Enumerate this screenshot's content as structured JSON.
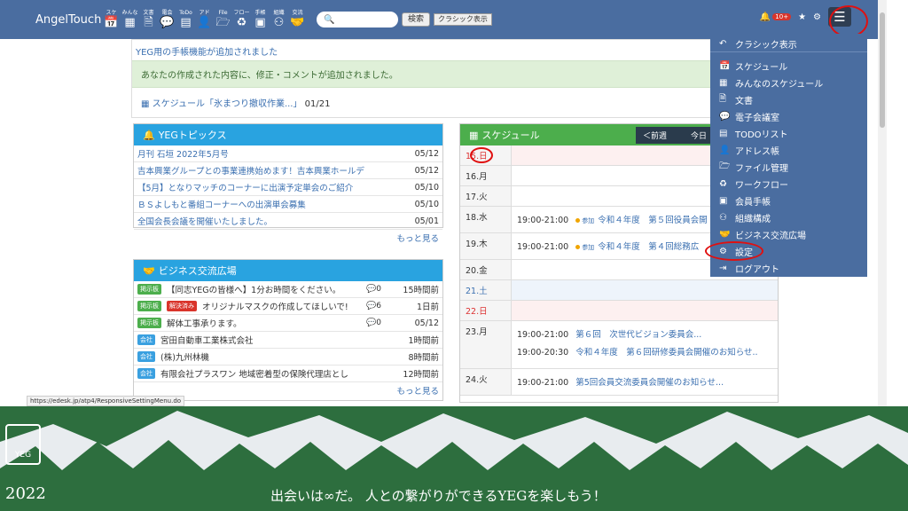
{
  "header": {
    "brand": "AngelTouch",
    "nav": [
      {
        "label": "スケ",
        "icon": "calendar-icon",
        "glyph": "📅"
      },
      {
        "label": "みんな",
        "icon": "group-calendar-icon",
        "glyph": "▦"
      },
      {
        "label": "文書",
        "icon": "document-icon",
        "glyph": "🗎"
      },
      {
        "label": "電会",
        "icon": "chat-icon",
        "glyph": "💬"
      },
      {
        "label": "ToDo",
        "icon": "todo-icon",
        "glyph": "▤"
      },
      {
        "label": "アド",
        "icon": "address-icon",
        "glyph": "👤"
      },
      {
        "label": "File",
        "icon": "folder-icon",
        "glyph": "🗁"
      },
      {
        "label": "フロー",
        "icon": "workflow-icon",
        "glyph": "♻"
      },
      {
        "label": "手帳",
        "icon": "notebook-icon",
        "glyph": "▣"
      },
      {
        "label": "組織",
        "icon": "org-icon",
        "glyph": "⚇"
      },
      {
        "label": "交流",
        "icon": "handshake-icon",
        "glyph": "🤝"
      }
    ],
    "search_placeholder": "",
    "search_button": "検索",
    "classic_button": "クラシック表示",
    "badge": "10+"
  },
  "notice": {
    "title": "YEG用の手帳機能が追加されました",
    "green": "あなたの作成された内容に、修正・コメントが追加されました。",
    "link": "スケジュール「氷まつり撤収作業...」",
    "link_date": "01/21"
  },
  "topics": {
    "title": "YEGトピックス",
    "rows": [
      {
        "title": "月刊 石垣 2022年5月号",
        "date": "05/12"
      },
      {
        "title": "吉本興業グループとの事業連携始めます！吉本興業ホールデ",
        "date": "05/12"
      },
      {
        "title": "【5月】となりマッチのコーナーに出演予定単会のご紹介",
        "date": "05/10"
      },
      {
        "title": "ＢＳよしもと番組コーナーへの出演単会募集",
        "date": "05/10"
      },
      {
        "title": "全国会長会議を開催いたしました。",
        "date": "05/01"
      }
    ],
    "more": "もっと見る"
  },
  "biz": {
    "title": "ビジネス交流広場",
    "rows": [
      {
        "tag": "掲示板",
        "tag2": "",
        "title": "【同志YEGの皆様へ】1分お時間をください。",
        "cmt": "0",
        "date": "15時間前"
      },
      {
        "tag": "掲示板",
        "tag2": "解決済み",
        "title": "オリジナルマスクの作成してほしいで!",
        "cmt": "6",
        "date": "1日前"
      },
      {
        "tag": "掲示板",
        "tag2": "",
        "title": "解体工事承ります。",
        "cmt": "0",
        "date": "05/12"
      },
      {
        "tag": "会社",
        "tag2": "",
        "title": "宮田自動車工業株式会社",
        "cmt": "",
        "date": "1時間前"
      },
      {
        "tag": "会社",
        "tag2": "",
        "title": "(株)九州林機",
        "cmt": "",
        "date": "8時間前"
      },
      {
        "tag": "会社",
        "tag2": "",
        "title": "有限会社プラスワン 地域密着型の保険代理店とし",
        "cmt": "",
        "date": "12時間前"
      }
    ],
    "more": "もっと見る"
  },
  "schedule": {
    "title": "スケジュール",
    "prev": "＜前週",
    "today": "今日",
    "days": [
      {
        "date": "15.日",
        "items": [],
        "color": "#d33",
        "bg": "#fdf0f0"
      },
      {
        "date": "16.月",
        "items": [],
        "color": "#333",
        "bg": "#fff"
      },
      {
        "date": "17.火",
        "items": [],
        "color": "#333",
        "bg": "#fff"
      },
      {
        "date": "18.水",
        "items": [
          {
            "tm": "19:00-21:00",
            "sanka": "参加",
            "title": "令和４年度　第５回役員会開"
          }
        ],
        "color": "#333",
        "bg": "#fff"
      },
      {
        "date": "19.木",
        "items": [
          {
            "tm": "19:00-21:00",
            "sanka": "参加",
            "title": "令和４年度　第４回総務広"
          }
        ],
        "color": "#333",
        "bg": "#fff"
      },
      {
        "date": "20.金",
        "items": [],
        "color": "#333",
        "bg": "#fff"
      },
      {
        "date": "21.土",
        "items": [],
        "color": "#3a6fb0",
        "bg": "#eef4fb"
      },
      {
        "date": "22.日",
        "items": [],
        "color": "#d33",
        "bg": "#fdf0f0"
      },
      {
        "date": "23.月",
        "items": [
          {
            "tm": "19:00-21:00",
            "sanka": "",
            "title": "第６回　次世代ビジョン委員会..."
          },
          {
            "tm": "19:00-20:30",
            "sanka": "",
            "title": "令和４年度　第６回研修委員会開催のお知らせ.."
          }
        ],
        "color": "#333",
        "bg": "#fff"
      },
      {
        "date": "24.火",
        "items": [
          {
            "tm": "19:00-21:00",
            "sanka": "",
            "title": "第5回会員交流委員会開催のお知らせ..."
          }
        ],
        "color": "#333",
        "bg": "#fff"
      }
    ]
  },
  "menu": [
    {
      "label": "クラシック表示",
      "icon": "undo-icon",
      "glyph": "↶"
    },
    {
      "label": "スケジュール",
      "icon": "calendar-icon",
      "glyph": "📅"
    },
    {
      "label": "みんなのスケジュール",
      "icon": "group-calendar-icon",
      "glyph": "▦"
    },
    {
      "label": "文書",
      "icon": "document-icon",
      "glyph": "🗎"
    },
    {
      "label": "電子会議室",
      "icon": "chat-icon",
      "glyph": "💬"
    },
    {
      "label": "TODOリスト",
      "icon": "todo-icon",
      "glyph": "▤"
    },
    {
      "label": "アドレス帳",
      "icon": "address-icon",
      "glyph": "👤"
    },
    {
      "label": "ファイル管理",
      "icon": "folder-icon",
      "glyph": "🗁"
    },
    {
      "label": "ワークフロー",
      "icon": "workflow-icon",
      "glyph": "♻"
    },
    {
      "label": "会員手帳",
      "icon": "notebook-icon",
      "glyph": "▣"
    },
    {
      "label": "組織構成",
      "icon": "org-icon",
      "glyph": "⚇"
    },
    {
      "label": "ビジネス交流広場",
      "icon": "handshake-icon",
      "glyph": "🤝"
    },
    {
      "label": "設定",
      "icon": "gear-icon",
      "glyph": "⚙"
    },
    {
      "label": "ログアウト",
      "icon": "logout-icon",
      "glyph": "⇥"
    }
  ],
  "status_url": "https://edesk.jp/atp4/ResponsiveSettingMenu.do",
  "banner": {
    "logo": "YEG",
    "year": "2022",
    "slogan": "出会いは∞だ。 人との繋がりができるYEGを楽しもう！"
  }
}
